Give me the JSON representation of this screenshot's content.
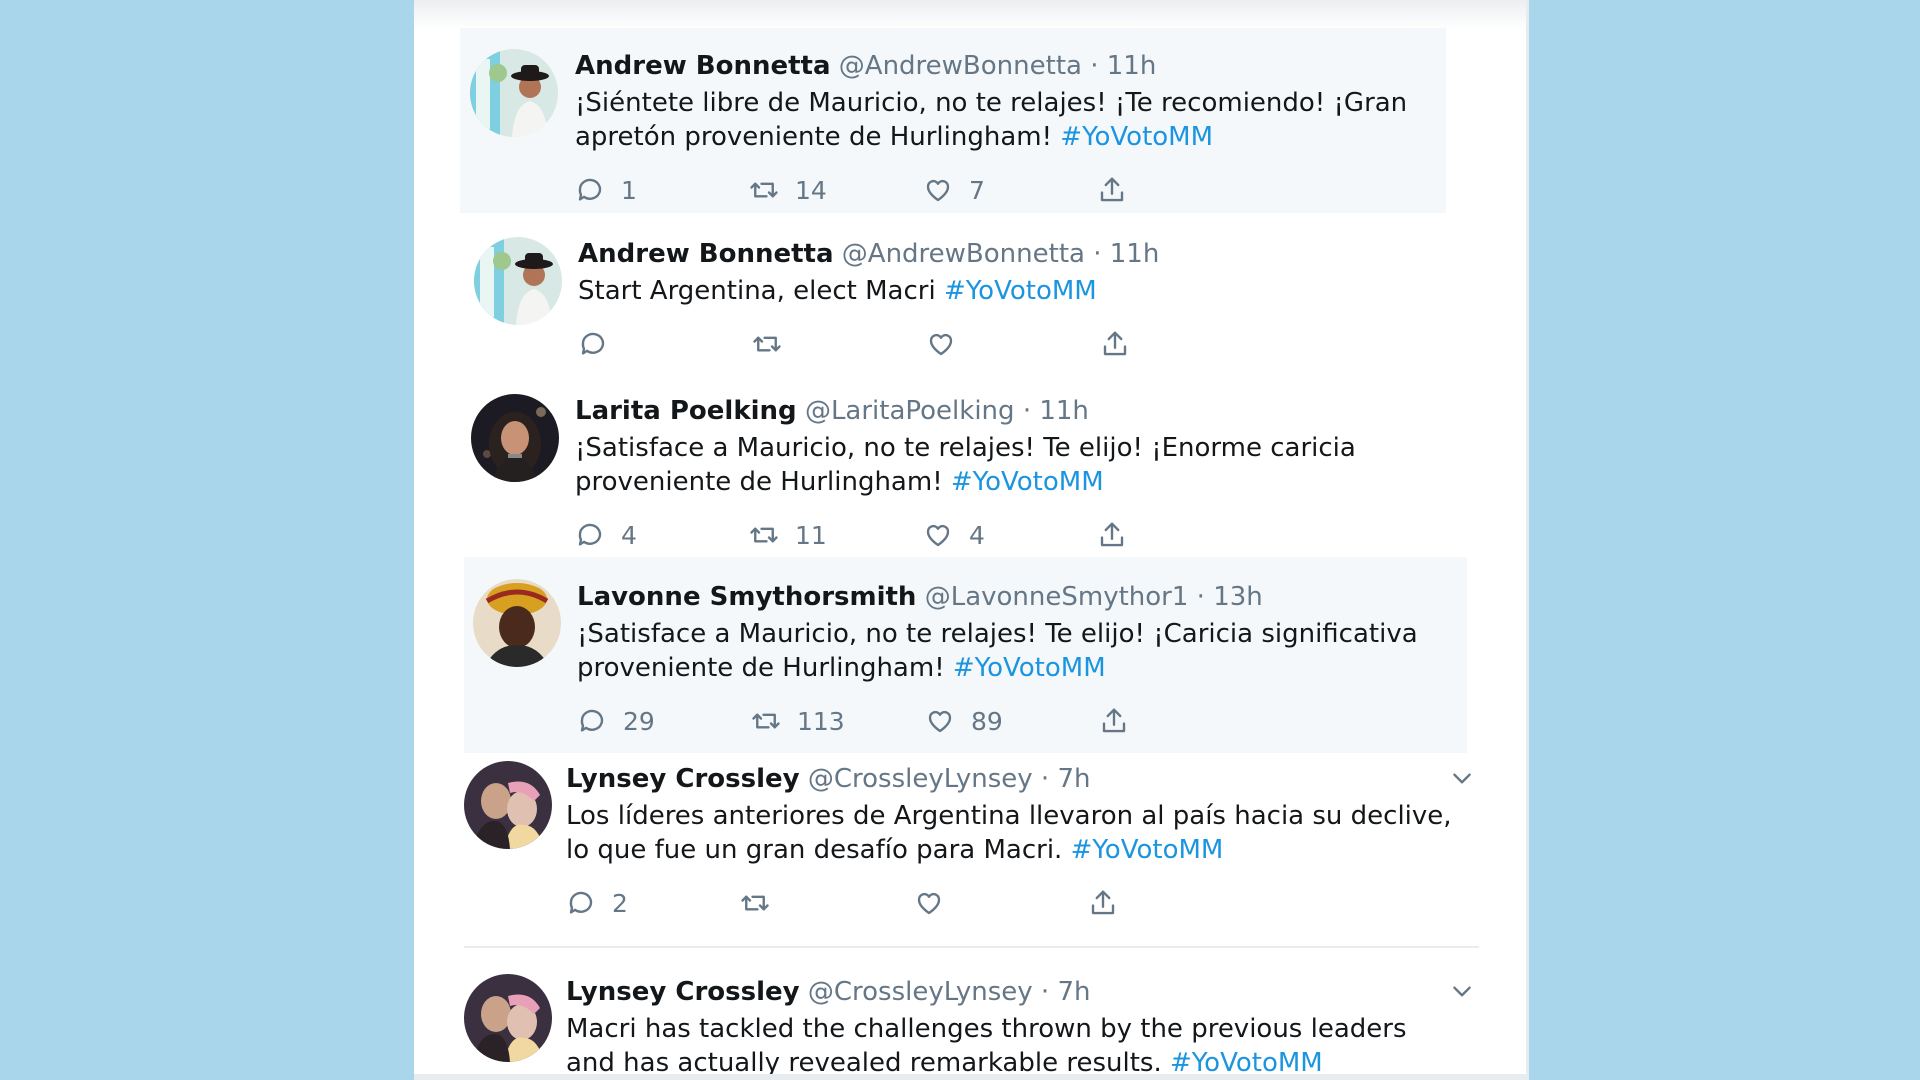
{
  "tweets": [
    {
      "name": "Andrew Bonnetta",
      "handle": "@AndrewBonnetta",
      "sep": "·",
      "time": "11h",
      "text": "¡Siéntete libre de Mauricio, no te relajes! ¡Te recomiendo! ¡Gran apretón proveniente de Hurlingham!",
      "hashtag": "#YoVotoMM",
      "replies": "1",
      "retweets": "14",
      "likes": "7"
    },
    {
      "name": "Andrew Bonnetta",
      "handle": "@AndrewBonnetta",
      "sep": "·",
      "time": "11h",
      "text": "Start Argentina, elect Macri",
      "hashtag": "#YoVotoMM",
      "replies": "",
      "retweets": "",
      "likes": ""
    },
    {
      "name": "Larita Poelking",
      "handle": "@LaritaPoelking",
      "sep": "·",
      "time": "11h",
      "text": "¡Satisface a Mauricio, no te relajes! Te elijo! ¡Enorme caricia proveniente de Hurlingham!",
      "hashtag": "#YoVotoMM",
      "replies": "4",
      "retweets": "11",
      "likes": "4"
    },
    {
      "name": "Lavonne Smythorsmith",
      "handle": "@LavonneSmythor1",
      "sep": "·",
      "time": "13h",
      "text": "¡Satisface a Mauricio, no te relajes! Te elijo! ¡Caricia significativa proveniente de Hurlingham!",
      "hashtag": "#YoVotoMM",
      "replies": "29",
      "retweets": "113",
      "likes": "89"
    },
    {
      "name": "Lynsey Crossley",
      "handle": "@CrossleyLynsey",
      "sep": "·",
      "time": "7h",
      "text": "Los líderes anteriores de Argentina llevaron al país hacia su declive, lo que fue un gran desafío para Macri.",
      "hashtag": "#YoVotoMM",
      "replies": "2",
      "retweets": "",
      "likes": ""
    },
    {
      "name": "Lynsey Crossley",
      "handle": "@CrossleyLynsey",
      "sep": "·",
      "time": "7h",
      "text": "Macri has tackled the challenges thrown by the previous leaders and has actually revealed remarkable results.",
      "hashtag": "#YoVotoMM",
      "replies": "",
      "retweets": "",
      "likes": ""
    }
  ],
  "icons": {
    "reply": "reply-icon",
    "retweet": "retweet-icon",
    "like": "like-icon",
    "share": "share-icon",
    "menu": "chevron-down-icon"
  },
  "colors": {
    "background": "#a9d6ea",
    "hashtag": "#1b95e0",
    "muted": "#657786",
    "highlight": "#f5f8fa"
  }
}
